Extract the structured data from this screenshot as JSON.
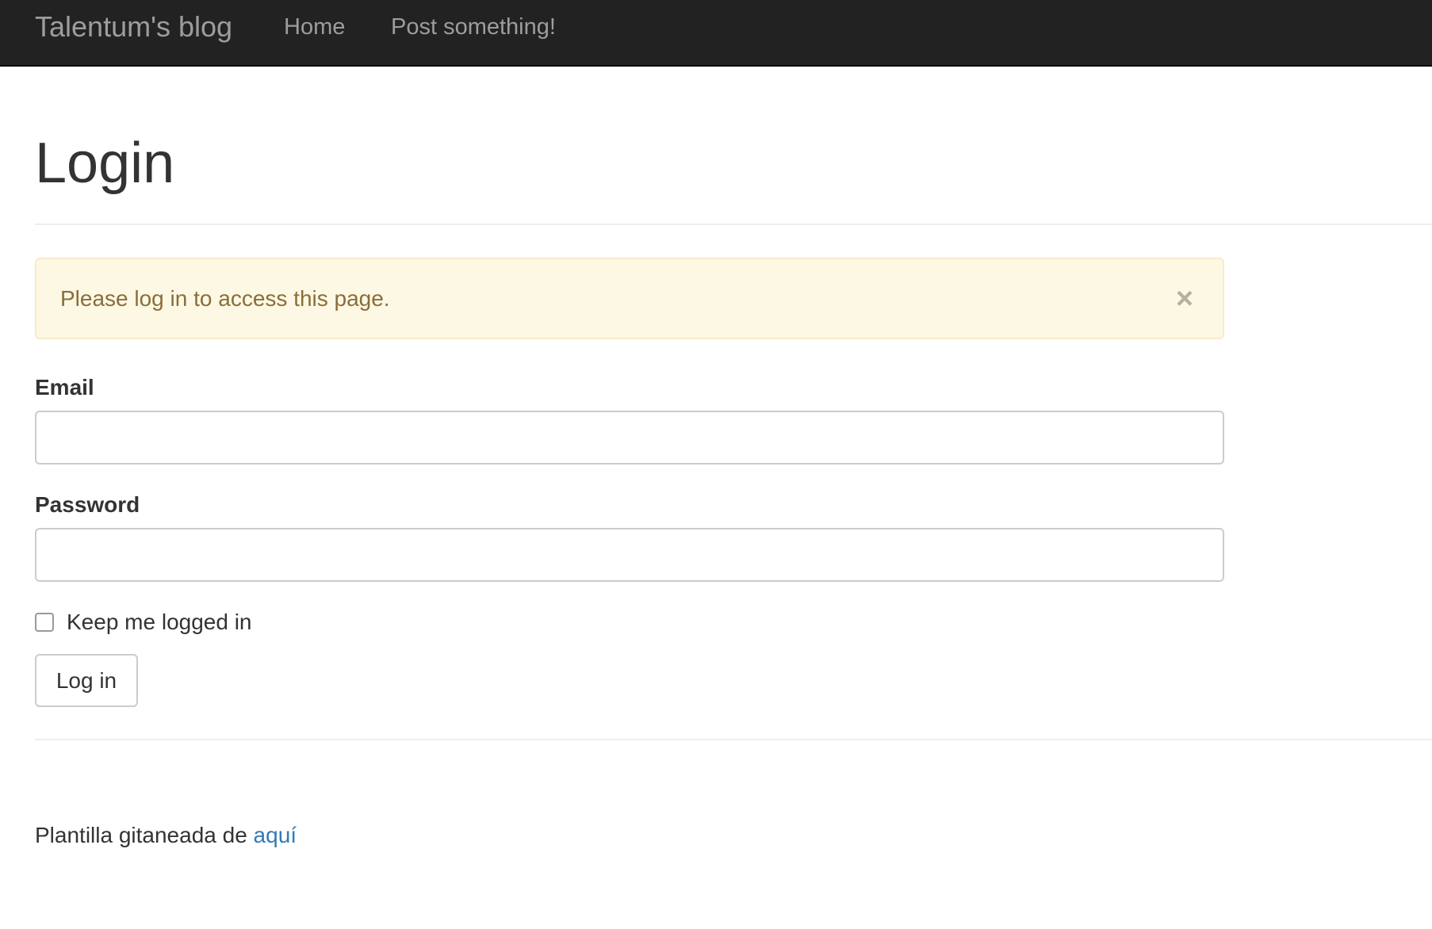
{
  "navbar": {
    "brand": "Talentum's blog",
    "links": [
      {
        "label": "Home"
      },
      {
        "label": "Post something!"
      }
    ]
  },
  "page": {
    "title": "Login"
  },
  "alert": {
    "message": "Please log in to access this page.",
    "close_glyph": "×",
    "colors": {
      "background": "#fcf8e3",
      "border": "#faebcc",
      "text": "#8a6d3b"
    }
  },
  "form": {
    "email_label": "Email",
    "email_value": "",
    "password_label": "Password",
    "password_value": "",
    "remember_label": "Keep me logged in",
    "remember_checked": false,
    "submit_label": "Log in"
  },
  "footer": {
    "text": "Plantilla gitaneada de ",
    "link_label": "aquí",
    "link_color": "#337ab7"
  },
  "colors": {
    "navbar_background": "#222222",
    "navbar_text": "#9d9d9d"
  }
}
